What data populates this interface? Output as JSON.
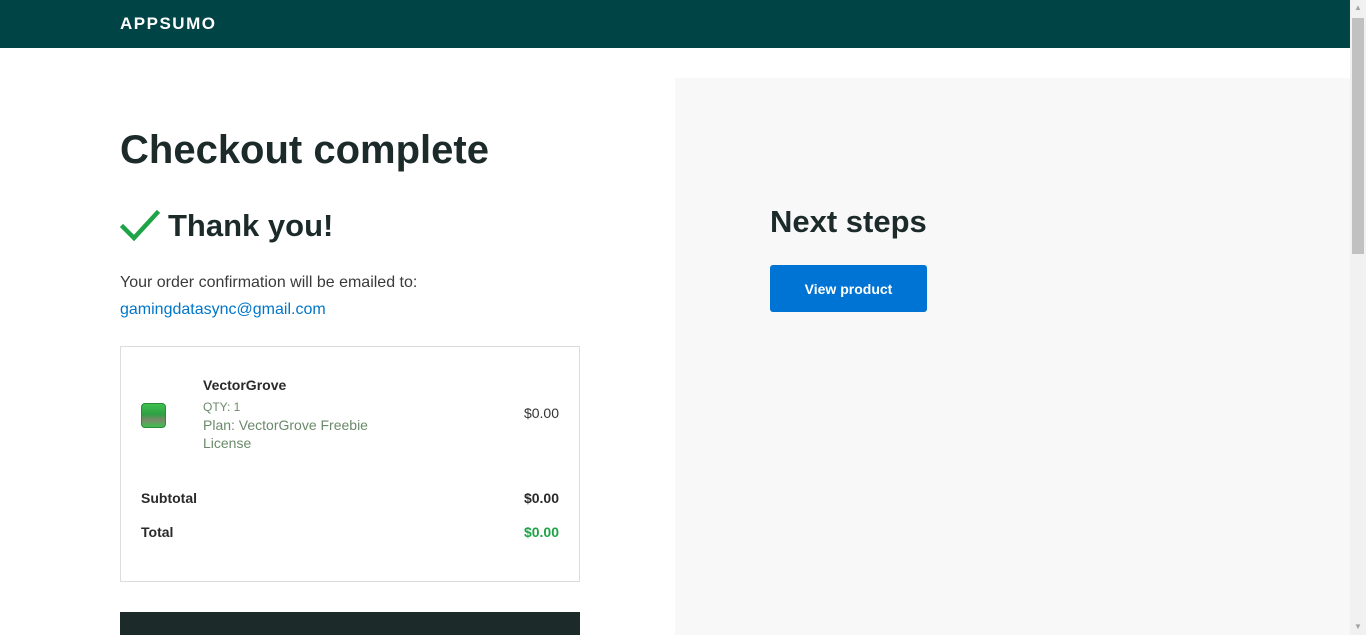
{
  "header": {
    "logo_text": "APPSUMO",
    "background_color": "#004445"
  },
  "checkout": {
    "title": "Checkout complete",
    "thanks": "Thank you!",
    "confirmation_text": "Your order confirmation will be emailed to:",
    "email": "gamingdatasync@gmail.com"
  },
  "order": {
    "product_name": "VectorGrove",
    "qty": "QTY: 1",
    "plan": "Plan: VectorGrove Freebie License",
    "price": "$0.00",
    "subtotal_label": "Subtotal",
    "subtotal_value": "$0.00",
    "total_label": "Total",
    "total_value": "$0.00",
    "total_color": "#1ea446"
  },
  "next_steps": {
    "title": "Next steps",
    "button_label": "View product",
    "button_color": "#0074d4"
  },
  "icons": {
    "check": "check-icon",
    "product": "product-thumbnail"
  }
}
